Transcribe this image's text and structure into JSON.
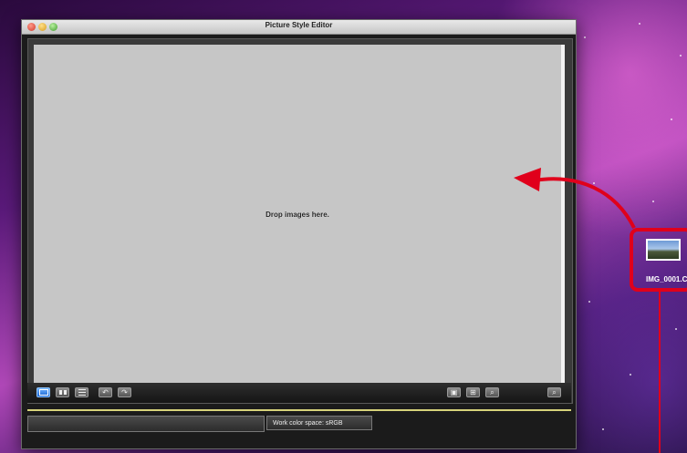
{
  "window": {
    "title": "Picture Style Editor"
  },
  "viewer": {
    "drop_hint": "Drop images here."
  },
  "toolbar": {
    "left_buttons": [
      {
        "icon": "single-view-icon",
        "active": true
      },
      {
        "icon": "side-by-side-view-icon",
        "active": false
      },
      {
        "icon": "split-view-icon",
        "active": false
      },
      {
        "icon": "rotate-left-icon",
        "active": false
      },
      {
        "icon": "rotate-right-icon",
        "active": false
      }
    ],
    "right_buttons": [
      {
        "icon": "fit-icon"
      },
      {
        "icon": "actual-size-icon"
      },
      {
        "icon": "zoom-icon"
      },
      {
        "icon": "zoom-magnifier-icon"
      }
    ]
  },
  "status": {
    "left_text": "",
    "work_color_space": "Work color space: sRGB"
  },
  "desktop": {
    "file_name": "IMG_0001.CR",
    "highlight_color": "#e0001b"
  }
}
